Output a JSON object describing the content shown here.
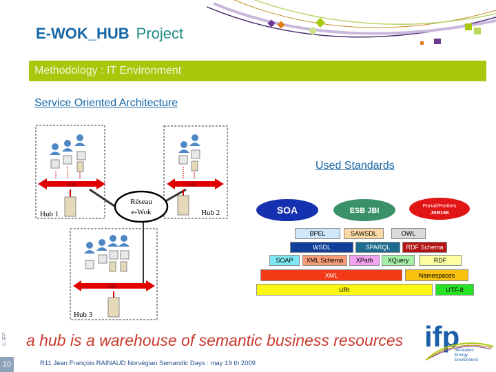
{
  "header": {
    "title_bold": "E-WOK_HUB",
    "title_rest": "Project",
    "section_band": "Methodology : IT Environment"
  },
  "left": {
    "heading": "Service Oriented Architecture",
    "diagram": {
      "bus_label": "ESB",
      "network_line1": "Réseau",
      "network_line2": "e-Wok",
      "hubs": [
        "Hub 1",
        "Hub 2",
        "Hub 3"
      ]
    }
  },
  "right": {
    "heading": "Used Standards",
    "ovals": [
      {
        "label": "SOA",
        "color": "#1530b0"
      },
      {
        "label": "ESB JBI",
        "color": "#3a9168"
      },
      {
        "label_line1": "Portail/Portlets",
        "label_line2": "JSR168",
        "color": "#e21515"
      }
    ],
    "layers": [
      [
        {
          "label": "BPEL",
          "color": "#cfe6fb",
          "text": "#000000"
        },
        {
          "label": "SAWSDL",
          "color": "#fbd9a6",
          "text": "#000000"
        },
        {
          "label": "OWL",
          "color": "#d9d9d9",
          "text": "#000000"
        }
      ],
      [
        {
          "label": "WSDL",
          "color": "#123f9a",
          "text": "#ffffff"
        },
        {
          "label": "SPARQL",
          "color": "#1d6b8f",
          "text": "#ffffff"
        },
        {
          "label": "RDF Schema",
          "color": "#b51313",
          "text": "#ffffff"
        }
      ],
      [
        {
          "label": "SOAP",
          "color": "#7fe7f3",
          "text": "#000000"
        },
        {
          "label": "XML Schema",
          "color": "#f79c78",
          "text": "#000000"
        },
        {
          "label": "XPath",
          "color": "#f3a2f0",
          "text": "#000000"
        },
        {
          "label": "XQuery",
          "color": "#a7f0a7",
          "text": "#000000"
        },
        {
          "label": "RDF",
          "color": "#fdfda1",
          "text": "#000000"
        }
      ],
      [
        {
          "label": "XML",
          "color": "#f33a17",
          "text": "#ffffff"
        },
        {
          "label": "Namespaces",
          "color": "#f9c10d",
          "text": "#000000"
        }
      ],
      [
        {
          "label": "URI",
          "color": "#fbf712",
          "text": "#000000"
        },
        {
          "label": "UTF-8",
          "color": "#27e227",
          "text": "#000000"
        }
      ]
    ]
  },
  "tagline": "a hub is a warehouse of semantic business resources",
  "footer": {
    "text": "R11 Jean François RAINAUD Norvégian Semandic Days : may 19 th 2009",
    "page_number": "10",
    "copyright": "© IFP"
  },
  "logo": {
    "letters": "ifp",
    "line1": "Innovation",
    "line2": "Energy",
    "line3": "Environment"
  },
  "colors": {
    "band": "#a9c70c",
    "title": "#1566a6",
    "tagline": "#c9392d",
    "bus": "#e00000"
  }
}
